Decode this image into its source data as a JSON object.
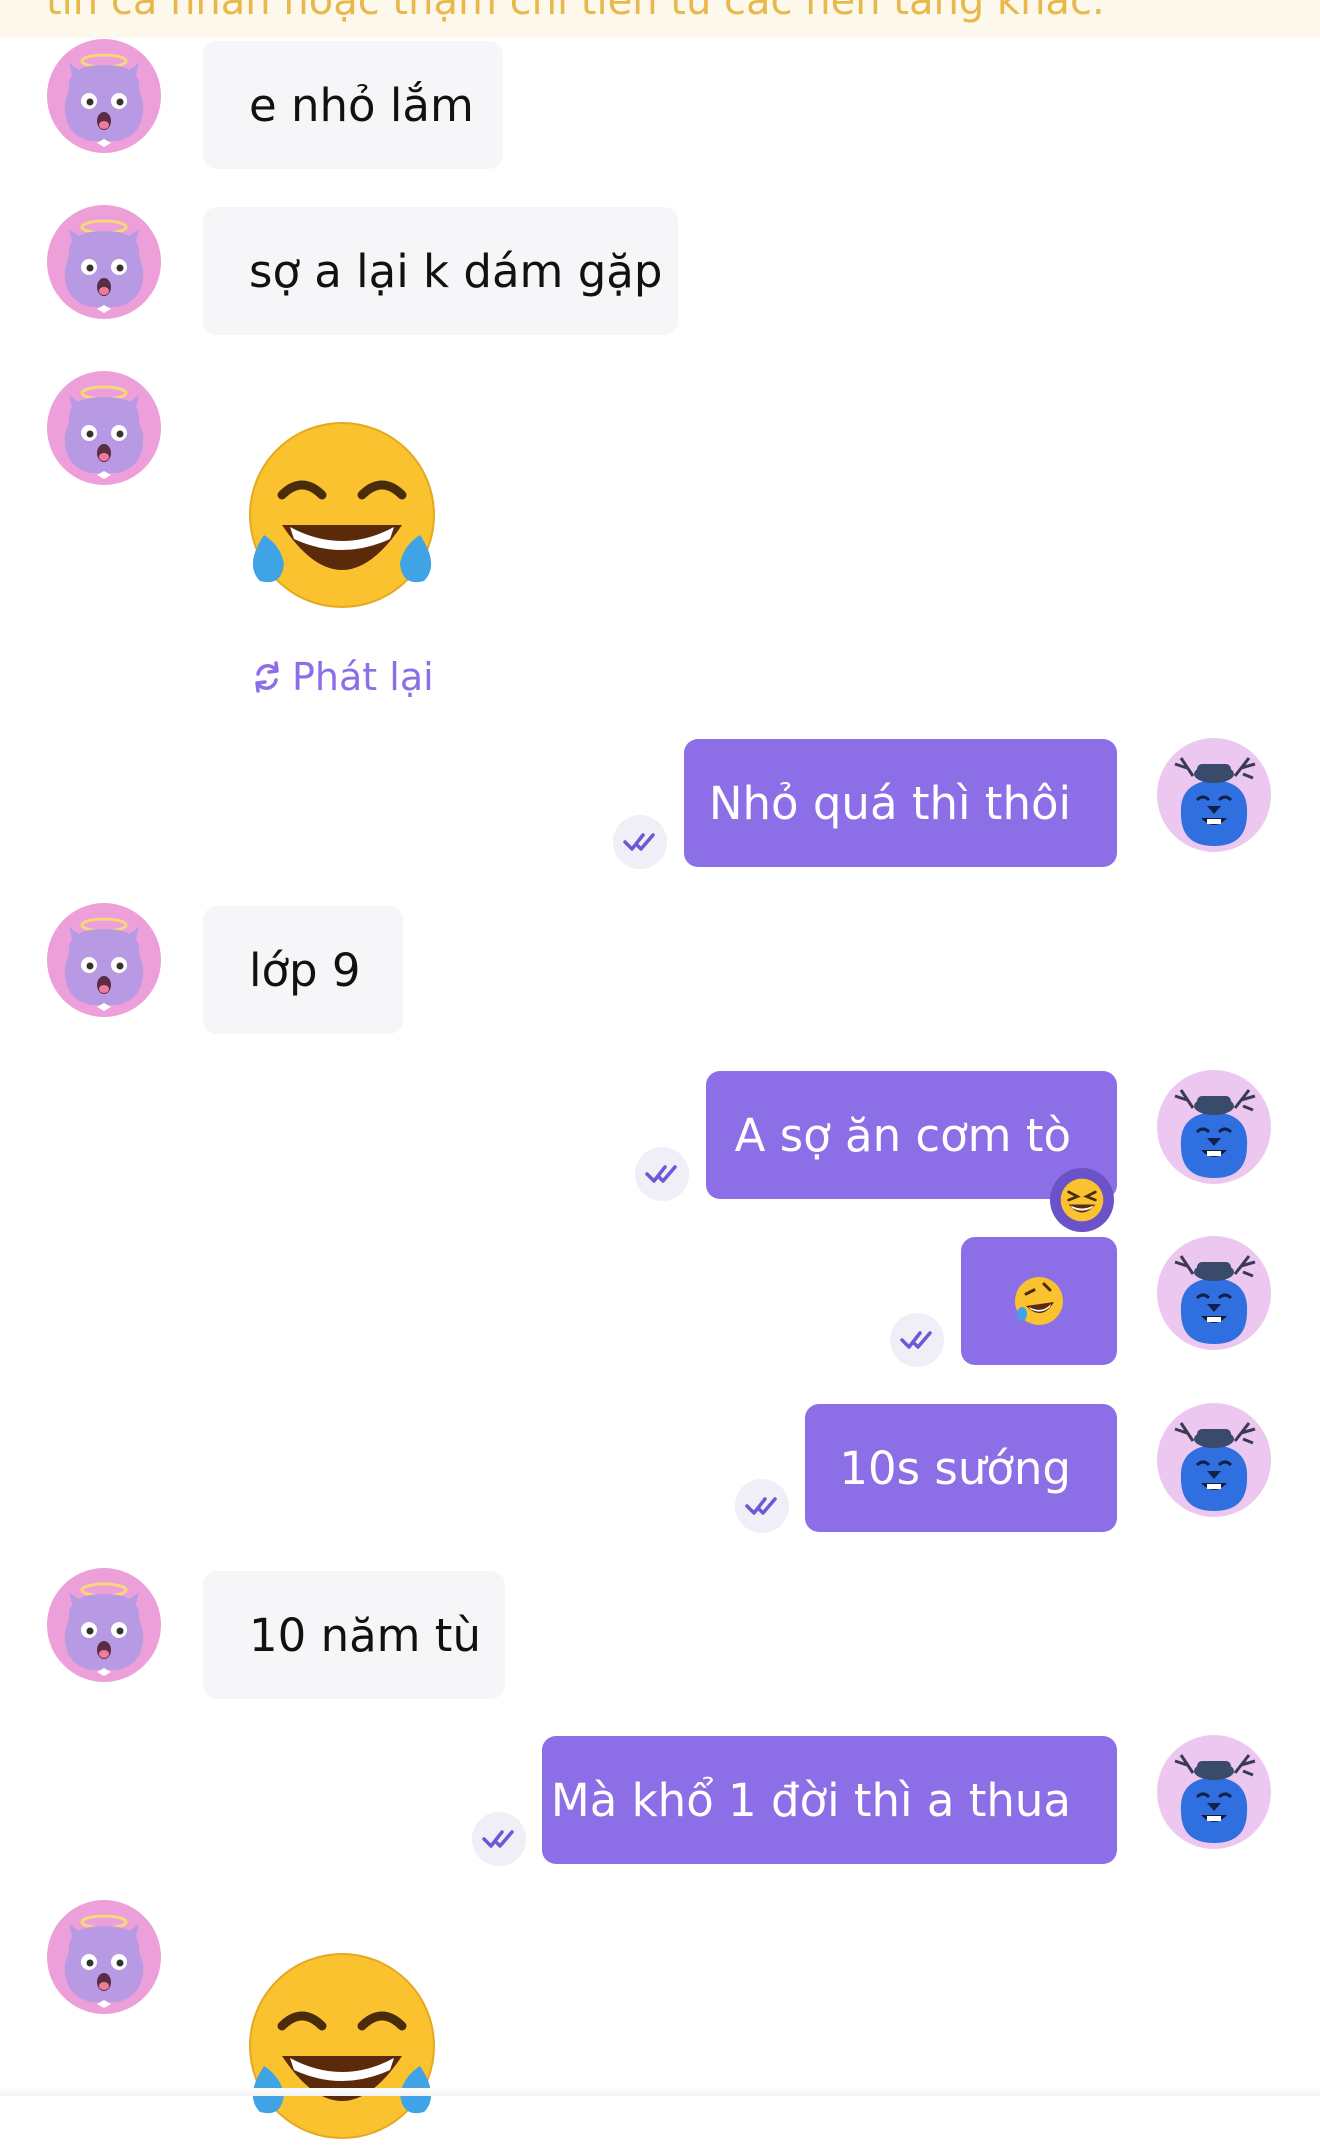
{
  "banner": {
    "text": "tin cá nhân hoặc thậm chí tiền từ các nền tảng khác."
  },
  "messages": [
    {
      "text": "e nhỏ lắm"
    },
    {
      "text": "sợ a lại k dám gặp"
    },
    {
      "text": "Nhỏ quá thì thôi"
    },
    {
      "text": "lớp 9"
    },
    {
      "text": "A sợ ăn cơm tò"
    },
    {
      "text": "10s sướng"
    },
    {
      "text": "10 năm tù"
    },
    {
      "text": "Mà khổ 1 đời thì a thua"
    }
  ],
  "sticker": {
    "replay_label": "Phát lại"
  },
  "icons": {
    "incoming_avatar": "purple-angel-avatar-icon",
    "outgoing_avatar": "blue-hat-avatar-icon",
    "seen": "double-check-icon",
    "laugh_cry": "face-with-tears-of-joy-icon",
    "rofl": "rolling-on-floor-laughing-icon",
    "grin_squint": "grinning-squinting-face-icon"
  },
  "colors": {
    "accent": "#8c6ee6",
    "incoming_bubble": "#f6f6f9",
    "banner_bg": "#fdf8ec",
    "banner_text": "#e9b84a"
  }
}
